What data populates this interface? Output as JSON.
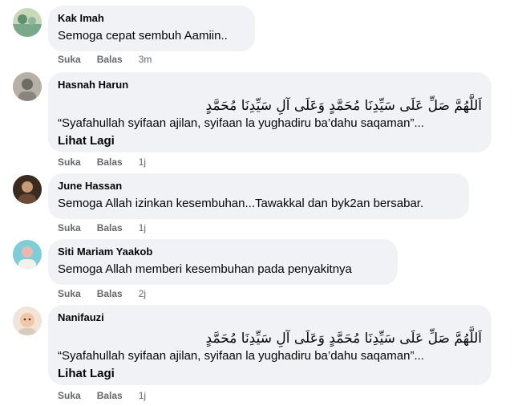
{
  "comments": [
    {
      "name": "Kak Imah",
      "text": "Semoga cepat sembuh Aamiin..",
      "like": "Suka",
      "reply": "Balas",
      "time": "3m",
      "avatar_colors": [
        "#7aa88a",
        "#c9d9b8"
      ]
    },
    {
      "name": "Hasnah Harun",
      "arabic": "اَللَّهُمَّ صَلِّ عَلَى سَيِّدِنَا مُحَمَّدٍ وَعَلَى آلِ سَيِّدِنَا مُحَمَّدٍ",
      "text": "“Syafahullah syifaan ajilan, syifaan la yughadiru ba’dahu saqaman”...",
      "see_more": "Lihat Lagi",
      "like": "Suka",
      "reply": "Balas",
      "time": "1j",
      "avatar_colors": [
        "#b7b0a6",
        "#6e6a64"
      ]
    },
    {
      "name": "June Hassan",
      "text": "Semoga Allah izinkan kesembuhan...Tawakkal dan byk2an bersabar.",
      "like": "Suka",
      "reply": "Balas",
      "time": "1j",
      "avatar_colors": [
        "#3b2a20",
        "#c59a74"
      ]
    },
    {
      "name": "Siti Mariam Yaakob",
      "text": "Semoga Allah memberi kesembuhan pada penyakitnya",
      "like": "Suka",
      "reply": "Balas",
      "time": "2j",
      "avatar_colors": [
        "#7fcdd6",
        "#e9b9b0"
      ]
    },
    {
      "name": "Nanifauzi",
      "arabic": "اَللَّهُمَّ صَلِّ عَلَى سَيِّدِنَا مُحَمَّدٍ وَعَلَى آلِ سَيِّدِنَا مُحَمَّدٍ",
      "text": "“Syafahullah syifaan ajilan, syifaan la yughadiru ba’dahu saqaman”...",
      "see_more": "Lihat Lagi",
      "like": "Suka",
      "reply": "Balas",
      "time": "1j",
      "avatar_colors": [
        "#f1e4d8",
        "#f2c7a6"
      ]
    }
  ]
}
